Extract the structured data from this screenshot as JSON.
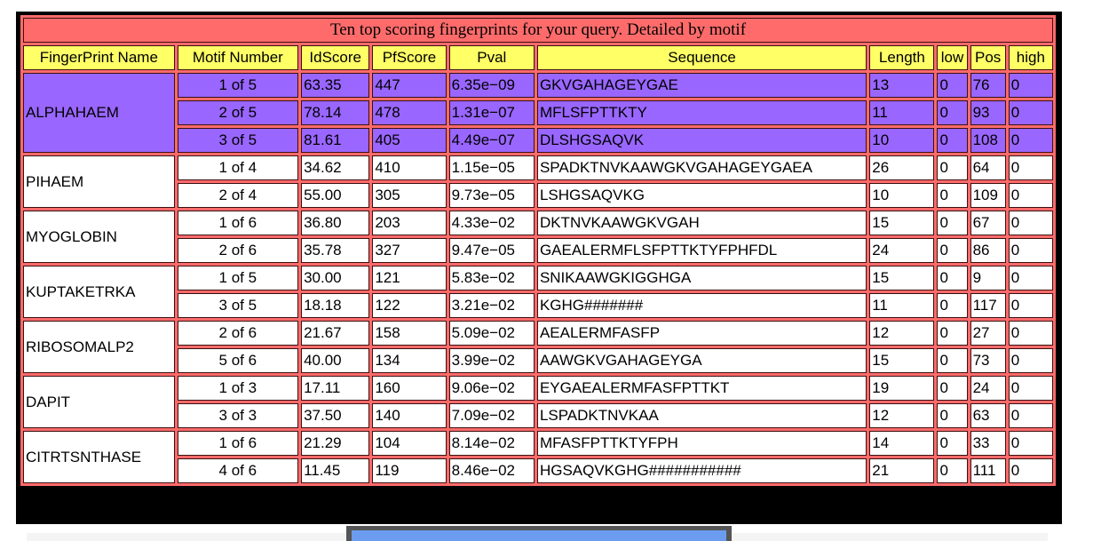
{
  "caption": "Ten top scoring fingerprints for your query. Detailed by motif",
  "headers": [
    "FingerPrint Name",
    "Motif Number",
    "IdScore",
    "PfScore",
    "Pval",
    "Sequence",
    "Length",
    "low",
    "Pos",
    "high"
  ],
  "colors": {
    "header_bg": "#ffff66",
    "border_bg": "#ff6b6b",
    "highlight_bg": "#9966ff"
  },
  "groups": [
    {
      "name": "ALPHAHAEM",
      "highlight": true,
      "rows": [
        {
          "motif": "1 of 5",
          "idscore": "63.35",
          "pfscore": "447",
          "pval": "6.35e−09",
          "sequence": "GKVGAHAGEYGAE",
          "length": "13",
          "low": "0",
          "pos": "76",
          "high": "0"
        },
        {
          "motif": "2 of 5",
          "idscore": "78.14",
          "pfscore": "478",
          "pval": "1.31e−07",
          "sequence": "MFLSFPTTKTY",
          "length": "11",
          "low": "0",
          "pos": "93",
          "high": "0"
        },
        {
          "motif": "3 of 5",
          "idscore": "81.61",
          "pfscore": "405",
          "pval": "4.49e−07",
          "sequence": "DLSHGSAQVK",
          "length": "10",
          "low": "0",
          "pos": "108",
          "high": "0"
        }
      ]
    },
    {
      "name": "PIHAEM",
      "highlight": false,
      "rows": [
        {
          "motif": "1 of 4",
          "idscore": "34.62",
          "pfscore": "410",
          "pval": "1.15e−05",
          "sequence": "SPADKTNVKAAWGKVGAHAGEYGAEA",
          "length": "26",
          "low": "0",
          "pos": "64",
          "high": "0"
        },
        {
          "motif": "2 of 4",
          "idscore": "55.00",
          "pfscore": "305",
          "pval": "9.73e−05",
          "sequence": "LSHGSAQVKG",
          "length": "10",
          "low": "0",
          "pos": "109",
          "high": "0"
        }
      ]
    },
    {
      "name": "MYOGLOBIN",
      "highlight": false,
      "rows": [
        {
          "motif": "1 of 6",
          "idscore": "36.80",
          "pfscore": "203",
          "pval": "4.33e−02",
          "sequence": "DKTNVKAAWGKVGAH",
          "length": "15",
          "low": "0",
          "pos": "67",
          "high": "0"
        },
        {
          "motif": "2 of 6",
          "idscore": "35.78",
          "pfscore": "327",
          "pval": "9.47e−05",
          "sequence": "GAEALERMFLSFPTTKTYFPHFDL",
          "length": "24",
          "low": "0",
          "pos": "86",
          "high": "0"
        }
      ]
    },
    {
      "name": "KUPTAKETRKA",
      "highlight": false,
      "rows": [
        {
          "motif": "1 of 5",
          "idscore": "30.00",
          "pfscore": "121",
          "pval": "5.83e−02",
          "sequence": "SNIKAAWGKIGGHGA",
          "length": "15",
          "low": "0",
          "pos": "9",
          "high": "0"
        },
        {
          "motif": "3 of 5",
          "idscore": "18.18",
          "pfscore": "122",
          "pval": "3.21e−02",
          "sequence": "KGHG#######",
          "length": "11",
          "low": "0",
          "pos": "117",
          "high": "0"
        }
      ]
    },
    {
      "name": "RIBOSOMALP2",
      "highlight": false,
      "rows": [
        {
          "motif": "2 of 6",
          "idscore": "21.67",
          "pfscore": "158",
          "pval": "5.09e−02",
          "sequence": "AEALERMFASFP",
          "length": "12",
          "low": "0",
          "pos": "27",
          "high": "0"
        },
        {
          "motif": "5 of 6",
          "idscore": "40.00",
          "pfscore": "134",
          "pval": "3.99e−02",
          "sequence": "AAWGKVGAHAGEYGA",
          "length": "15",
          "low": "0",
          "pos": "73",
          "high": "0"
        }
      ]
    },
    {
      "name": "DAPIT",
      "highlight": false,
      "rows": [
        {
          "motif": "1 of 3",
          "idscore": "17.11",
          "pfscore": "160",
          "pval": "9.06e−02",
          "sequence": "EYGAEALERMFASFPTTKT",
          "length": "19",
          "low": "0",
          "pos": "24",
          "high": "0"
        },
        {
          "motif": "3 of 3",
          "idscore": "37.50",
          "pfscore": "140",
          "pval": "7.09e−02",
          "sequence": "LSPADKTNVKAA",
          "length": "12",
          "low": "0",
          "pos": "63",
          "high": "0"
        }
      ]
    },
    {
      "name": "CITRTSNTHASE",
      "highlight": false,
      "rows": [
        {
          "motif": "1 of 6",
          "idscore": "21.29",
          "pfscore": "104",
          "pval": "8.14e−02",
          "sequence": "MFASFPTTKTYFPH",
          "length": "14",
          "low": "0",
          "pos": "33",
          "high": "0"
        },
        {
          "motif": "4 of 6",
          "idscore": "11.45",
          "pfscore": "119",
          "pval": "8.46e−02",
          "sequence": "HGSAQVKGHG###########",
          "length": "21",
          "low": "0",
          "pos": "111",
          "high": "0"
        }
      ]
    }
  ]
}
